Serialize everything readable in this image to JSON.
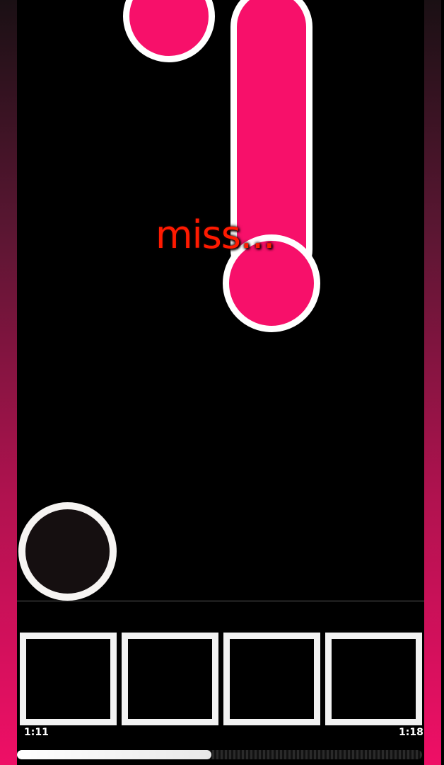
{
  "colors": {
    "note_fill": "#f7106a",
    "note_outline": "#ffffff",
    "judgement_text": "#ff1a00",
    "touch_button_fill": "#150f10",
    "key_outline": "#f2f2f2",
    "side_gradient_top": "#1a1014",
    "side_gradient_bottom": "#ef0f66"
  },
  "judgement": {
    "text": "miss..."
  },
  "keys": [
    {
      "name": "lane-1"
    },
    {
      "name": "lane-2"
    },
    {
      "name": "lane-3"
    },
    {
      "name": "lane-4"
    }
  ],
  "timeline": {
    "start_time": "1:11",
    "end_time": "1:18",
    "progress_fraction": 0.48
  }
}
